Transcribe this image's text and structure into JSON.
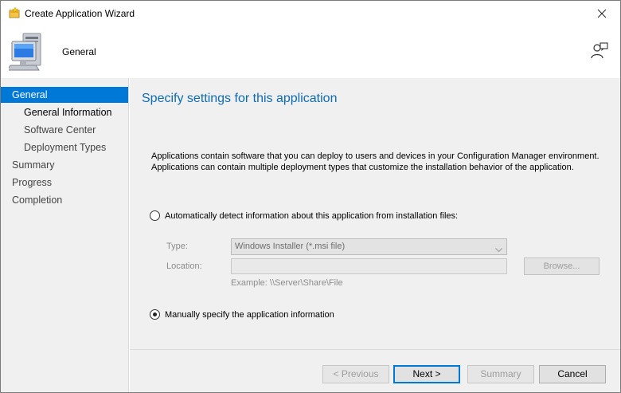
{
  "window": {
    "title": "Create Application Wizard"
  },
  "header": {
    "title": "General"
  },
  "nav": {
    "items": [
      {
        "label": "General",
        "level": 0,
        "selected": true
      },
      {
        "label": "General Information",
        "level": 1,
        "current": true
      },
      {
        "label": "Software Center",
        "level": 1
      },
      {
        "label": "Deployment Types",
        "level": 1
      },
      {
        "label": "Summary",
        "level": 0
      },
      {
        "label": "Progress",
        "level": 0
      },
      {
        "label": "Completion",
        "level": 0
      }
    ]
  },
  "content": {
    "title": "Specify settings for this application",
    "intro_line1": "Applications contain software that you can deploy to users and devices in your Configuration Manager environment.",
    "intro_line2": "Applications can contain multiple deployment types that customize the installation behavior of the application.",
    "auto_detect": {
      "label": "Automatically detect information about this application from installation files:",
      "checked": false
    },
    "type": {
      "label": "Type:",
      "value": "Windows Installer (*.msi file)"
    },
    "location": {
      "label": "Location:",
      "value": ""
    },
    "browse_label": "Browse...",
    "example": "Example: \\\\Server\\Share\\File",
    "manual": {
      "label": "Manually specify the application information",
      "checked": true
    }
  },
  "footer": {
    "previous": "< Previous",
    "next": "Next >",
    "summary": "Summary",
    "cancel": "Cancel"
  },
  "colors": {
    "accent": "#0078d7",
    "title_blue": "#0e6bb5",
    "panel": "#f0f0f0"
  }
}
